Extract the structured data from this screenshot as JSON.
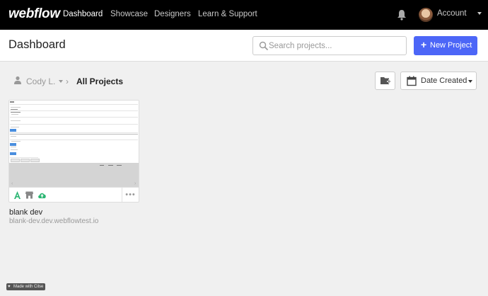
{
  "nav": {
    "logo": "webflow",
    "links": [
      "Dashboard",
      "Showcase",
      "Designers",
      "Learn & Support"
    ],
    "account_label": "Account"
  },
  "header": {
    "title": "Dashboard",
    "search_placeholder": "Search projects...",
    "new_project_label": "New Project"
  },
  "breadcrumb": {
    "user": "Cody L.",
    "current": "All Projects"
  },
  "sort": {
    "selected": "Date Created"
  },
  "projects": [
    {
      "name": "blank dev",
      "url": "blank-dev.dev.webflowtest.io"
    }
  ],
  "badge": "Made with Cilse",
  "colors": {
    "primary": "#4c66f7",
    "nav_bg": "#000000",
    "page_bg": "#f0f0f0",
    "green": "#2bb673"
  }
}
